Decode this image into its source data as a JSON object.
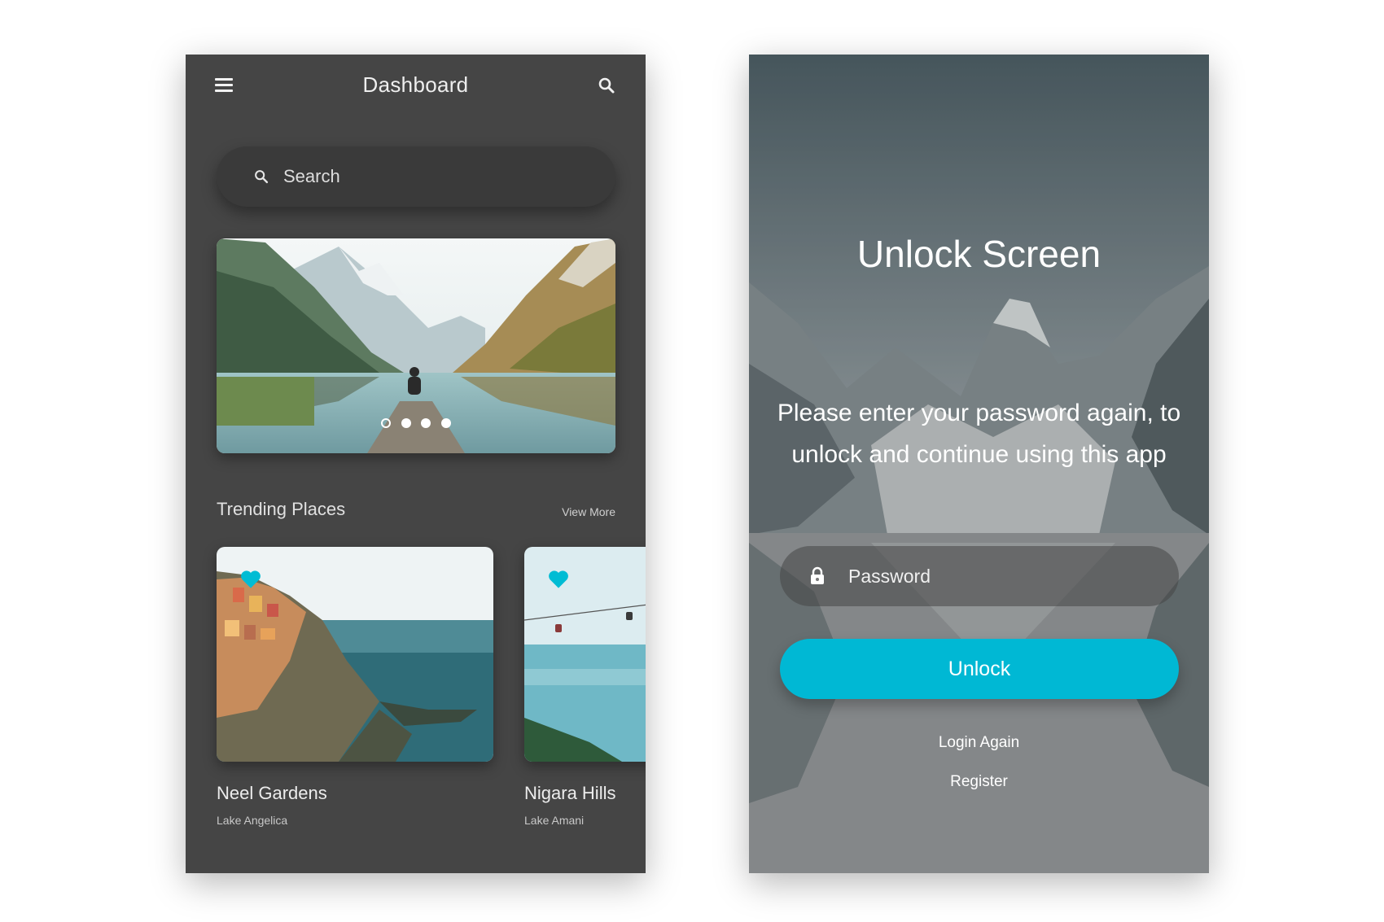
{
  "dashboard": {
    "title": "Dashboard",
    "search": {
      "placeholder": "Search"
    },
    "carousel": {
      "slide_count": 4,
      "active_index": 0
    },
    "section": {
      "title": "Trending Places",
      "view_more": "View More"
    },
    "cards": [
      {
        "title": "Neel Gardens",
        "subtitle": "Lake Angelica",
        "favorited": true
      },
      {
        "title": "Nigara Hills",
        "subtitle": "Lake Amani",
        "favorited": true
      }
    ],
    "colors": {
      "background": "#454545",
      "accent": "#00b8d4",
      "text": "#eeeeee"
    }
  },
  "unlock": {
    "title": "Unlock Screen",
    "message": "Please enter your password again, to unlock and continue using this app",
    "password": {
      "placeholder": "Password"
    },
    "button": "Unlock",
    "login_again": "Login Again",
    "register": "Register",
    "colors": {
      "button": "#00b8d4",
      "text": "#ffffff"
    }
  },
  "icons": [
    "menu-icon",
    "search-icon",
    "heart-icon",
    "lock-icon"
  ]
}
